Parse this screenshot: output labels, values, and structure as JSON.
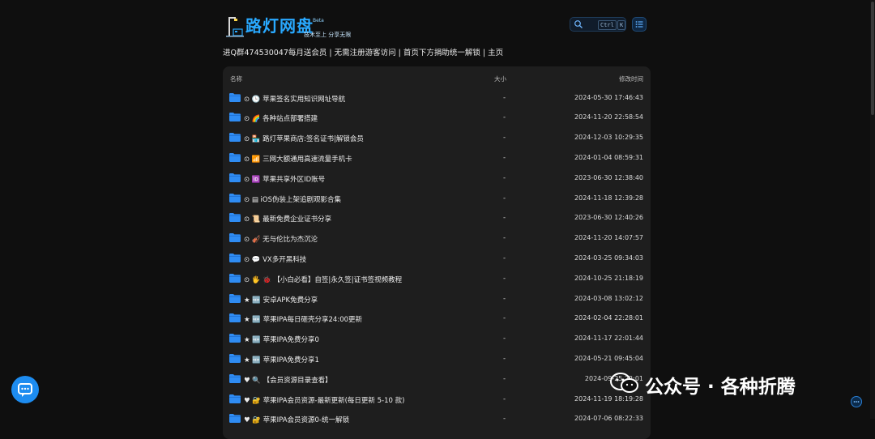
{
  "header": {
    "logo_title": "路灯网盘",
    "logo_beta": "Beta",
    "logo_slogan": "技术至上 分享无限",
    "search_kbd_ctrl": "Ctrl",
    "search_kbd_k": "K"
  },
  "notice": {
    "text": "进Q群474530047每月送会员 | 无需注册游客访问 | 首页下方捐助统一解锁  | 主页"
  },
  "table": {
    "headers": {
      "name": "名称",
      "size": "大小",
      "modified": "修改时间"
    },
    "rows": [
      {
        "name": "⊙ 🕒 苹果签名实用知识网址导航",
        "size": "-",
        "modified": "2024-05-30 17:46:43"
      },
      {
        "name": "⊙ 🌈 各种站点部署搭建",
        "size": "-",
        "modified": "2024-11-20 22:58:54"
      },
      {
        "name": "⊙ 🏪 路灯苹果商店:签名证书|解锁会员",
        "size": "-",
        "modified": "2024-12-03 10:29:35"
      },
      {
        "name": "⊙ 📶 三网大额通用高速流量手机卡",
        "size": "-",
        "modified": "2024-01-04 08:59:31"
      },
      {
        "name": "⊙ 🆔 苹果共享外区ID账号",
        "size": "-",
        "modified": "2023-06-30 12:38:40"
      },
      {
        "name": "⊙ ▤ iOS伪装上架追剧观影合集",
        "size": "-",
        "modified": "2024-11-18 12:39:28"
      },
      {
        "name": "⊙ 📜 最新免费企业证书分享",
        "size": "-",
        "modified": "2023-06-30 12:40:26"
      },
      {
        "name": "⊙ 🎻 无与伦比为杰沉沦",
        "size": "-",
        "modified": "2024-11-20 14:07:57"
      },
      {
        "name": "⊙ 💬 VX多开黑科技",
        "size": "-",
        "modified": "2024-03-25 09:34:03"
      },
      {
        "name": "⊙ 🖐 🐞 【小白必看】自签|永久签|证书签视频教程",
        "size": "-",
        "modified": "2024-10-25 21:18:19"
      },
      {
        "name": "★ 🆕 安卓APK免费分享",
        "size": "-",
        "modified": "2024-03-08 13:02:12"
      },
      {
        "name": "★ 🆕 苹果IPA每日砸壳分享24:00更新",
        "size": "-",
        "modified": "2024-02-04 22:28:01"
      },
      {
        "name": "★ 🆕 苹果IPA免费分享0",
        "size": "-",
        "modified": "2024-11-17 22:01:44"
      },
      {
        "name": "★ 🆕 苹果IPA免费分享1",
        "size": "-",
        "modified": "2024-05-21 09:45:04"
      },
      {
        "name": "♥ 🔍 【会员资源目录查看】",
        "size": "-",
        "modified": "2024-09-25 22:01"
      },
      {
        "name": "♥ 🔐 苹果IPA会员资源-最新更新(每日更新 5-10 款)",
        "size": "-",
        "modified": "2024-11-19 18:19:28"
      },
      {
        "name": "♥ 🔐 苹果IPA会员资源0-统一解锁",
        "size": "-",
        "modified": "2024-07-06 08:22:33"
      }
    ]
  },
  "watermark": {
    "text": "公众号 · 各种折腾"
  },
  "colors": {
    "accent": "#1d8cf0",
    "folder": "#2f8cf3",
    "background": "#0f0f0f",
    "panel": "#1e1e1e"
  },
  "icons": [
    "lamp-logo-icon",
    "search-icon",
    "list-menu-icon",
    "folder-icon",
    "chat-bubble-icon",
    "wechat-icon",
    "more-icon"
  ]
}
